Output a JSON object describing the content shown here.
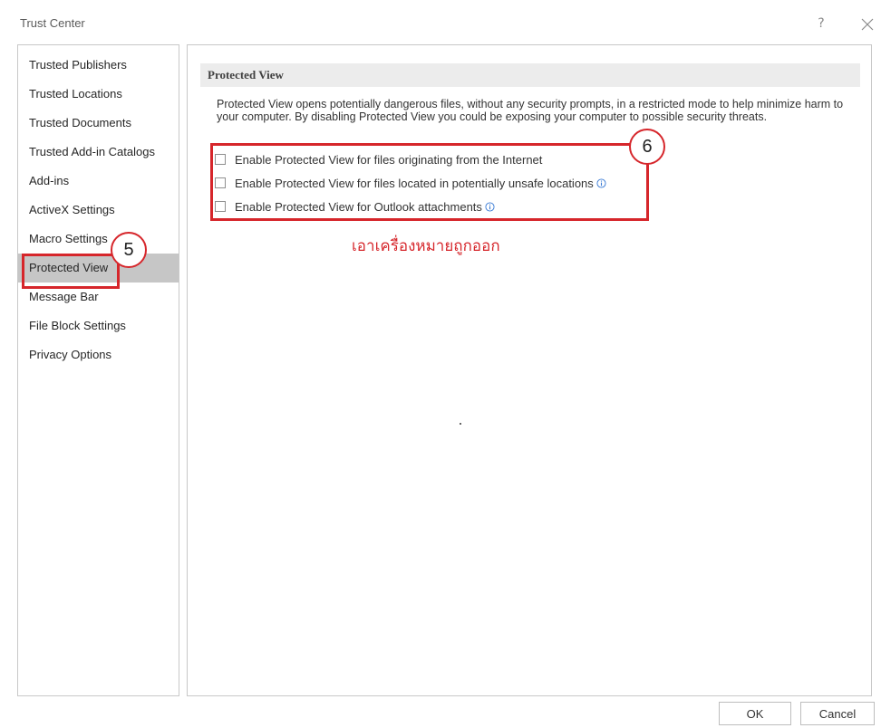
{
  "window": {
    "title": "Trust Center",
    "help_label": "?"
  },
  "sidebar": {
    "items": [
      {
        "label": "Trusted Publishers"
      },
      {
        "label": "Trusted Locations"
      },
      {
        "label": "Trusted Documents"
      },
      {
        "label": "Trusted Add-in Catalogs"
      },
      {
        "label": "Add-ins"
      },
      {
        "label": "ActiveX Settings"
      },
      {
        "label": "Macro Settings"
      },
      {
        "label": "Protected View",
        "selected": true
      },
      {
        "label": "Message Bar"
      },
      {
        "label": "File Block Settings"
      },
      {
        "label": "Privacy Options"
      }
    ]
  },
  "main": {
    "section_title": "Protected View",
    "description": "Protected View opens potentially dangerous files, without any security prompts, in a restricted mode to help minimize harm to your computer. By disabling Protected View you could be exposing your computer to possible security threats.",
    "options": [
      {
        "label": "Enable Protected View for files originating from the Internet",
        "checked": false,
        "info": false
      },
      {
        "label": "Enable Protected View for files located in potentially unsafe locations",
        "checked": false,
        "info": true
      },
      {
        "label": "Enable Protected View for Outlook attachments",
        "checked": false,
        "info": true
      }
    ]
  },
  "annotations": {
    "step5": "5",
    "step6": "6",
    "note": "เอาเครื่องหมายถูกออก",
    "color": "#d6262b"
  },
  "footer": {
    "ok_label": "OK",
    "cancel_label": "Cancel"
  }
}
